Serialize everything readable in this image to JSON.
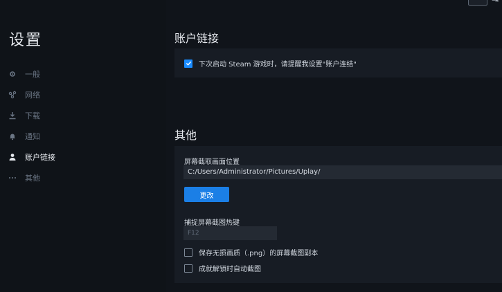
{
  "sidebar": {
    "title": "设置",
    "items": [
      {
        "label": "一般",
        "icon": "gear-icon"
      },
      {
        "label": "网络",
        "icon": "network-icon"
      },
      {
        "label": "下载",
        "icon": "download-icon"
      },
      {
        "label": "通知",
        "icon": "bell-icon"
      },
      {
        "label": "账户链接",
        "icon": "user-icon",
        "active": true
      },
      {
        "label": "其他",
        "icon": "more-icon"
      }
    ]
  },
  "account_section": {
    "title": "账户链接",
    "steam_reminder_label": "下次启动 Steam 游戏时，请提醒我设置\"账户连结\"",
    "steam_reminder_checked": true
  },
  "other_section": {
    "title": "其他",
    "screenshot_location_label": "屏幕截取画面位置",
    "screenshot_location_value": "C:/Users/Administrator/Pictures/Uplay/",
    "change_button_label": "更改",
    "hotkey_label": "捕捉屏幕截图热键",
    "hotkey_value": "F12",
    "lossless_png_label": "保存无损画质（.png）的屏幕截图副本",
    "lossless_png_checked": false,
    "auto_screenshot_label": "成就解锁时自动截图",
    "auto_screenshot_checked": false
  },
  "colors": {
    "accent": "#1b7fe6",
    "background": "#10141a",
    "panel": "#171c24"
  }
}
